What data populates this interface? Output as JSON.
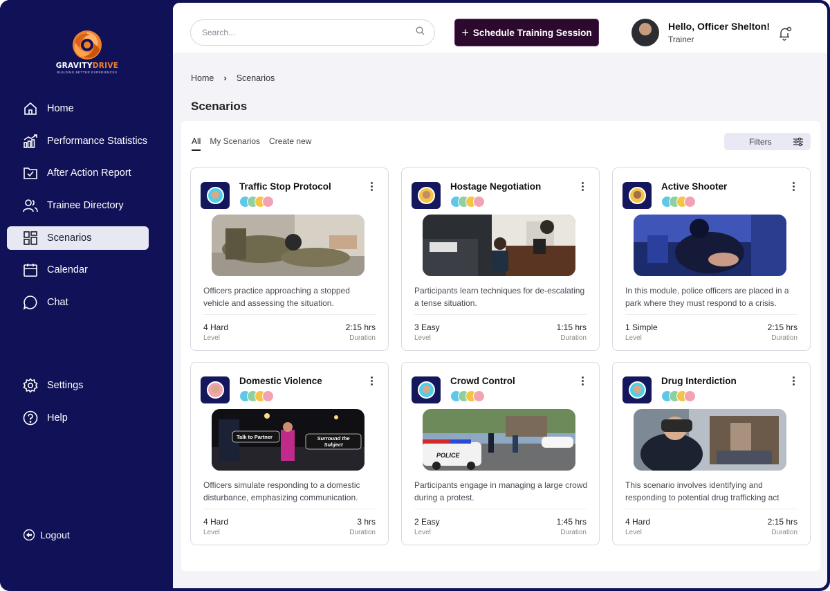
{
  "brand": {
    "name_primary": "GRAVITY",
    "name_accent": "DRIVE",
    "tagline": "BUILDING BETTER EXPERIENCES",
    "accent_color": "#f0812c",
    "sidebar_color": "#111158"
  },
  "sidebar": {
    "items": [
      {
        "label": "Home",
        "icon": "home-icon"
      },
      {
        "label": "Performance Statistics",
        "icon": "bar-chart-icon"
      },
      {
        "label": "After Action Report",
        "icon": "report-check-icon"
      },
      {
        "label": "Trainee Directory",
        "icon": "users-icon"
      },
      {
        "label": "Scenarios",
        "icon": "grid-icon",
        "active": true
      },
      {
        "label": "Calendar",
        "icon": "calendar-icon"
      },
      {
        "label": "Chat",
        "icon": "chat-icon"
      }
    ],
    "bottom_items": [
      {
        "label": "Settings",
        "icon": "gear-icon"
      },
      {
        "label": "Help",
        "icon": "help-icon"
      }
    ],
    "logout_label": "Logout"
  },
  "header": {
    "search_placeholder": "Search...",
    "schedule_label": "Schedule Training Session",
    "greeting": "Hello, Officer Shelton!",
    "role": "Trainer"
  },
  "breadcrumb": {
    "home": "Home",
    "current": "Scenarios"
  },
  "page_title": "Scenarios",
  "tabs": [
    "All",
    "My Scenarios",
    "Create new"
  ],
  "filters_label": "Filters",
  "scenarios": [
    {
      "title": "Traffic Stop Protocol",
      "description": "Officers practice approaching a stopped vehicle and  assessing the situation.",
      "level": "4 Hard",
      "level_label": "Level",
      "duration": "2:15 hrs",
      "duration_label": "Duration"
    },
    {
      "title": "Hostage Negotiation",
      "description": "Participants learn techniques for de-escalating a tense situation.",
      "level": "3 Easy",
      "level_label": "Level",
      "duration": "1:15 hrs",
      "duration_label": "Duration"
    },
    {
      "title": "Active Shooter",
      "description": "In this module, police officers are placed in a park where they must respond to a crisis.",
      "level": "1 Simple",
      "level_label": "Level",
      "duration": "2:15 hrs",
      "duration_label": "Duration"
    },
    {
      "title": "Domestic Violence",
      "description": "Officers simulate responding to a domestic disturbance, emphasizing communication.",
      "level": "4 Hard",
      "level_label": "Level",
      "duration": "3 hrs",
      "duration_label": "Duration",
      "thumb_labels": [
        "Talk to Partner",
        "Surround the Subject"
      ]
    },
    {
      "title": "Crowd Control",
      "description": "Participants engage in managing a large crowd during a protest.",
      "level": "2 Easy",
      "level_label": "Level",
      "duration": "1:45 hrs",
      "duration_label": "Duration",
      "thumb_labels": [
        "POLICE"
      ]
    },
    {
      "title": "Drug Interdiction",
      "description": "This scenario involves identifying and responding to potential drug trafficking act",
      "level": "4 Hard",
      "level_label": "Level",
      "duration": "2:15 hrs",
      "duration_label": "Duration"
    }
  ]
}
